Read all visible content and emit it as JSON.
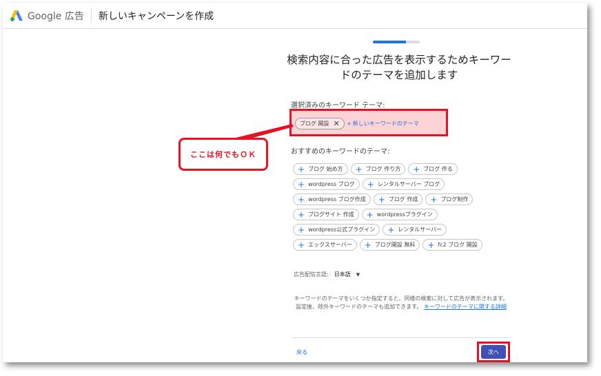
{
  "header": {
    "brand": "Google 広告",
    "title": "新しいキャンペーンを作成"
  },
  "progress": {
    "fraction": 0.7
  },
  "heading": "検索内容に合った広告を表示するためキーワードのテーマを追加します",
  "selected": {
    "label": "選択済みのキーワード テーマ:",
    "chips": [
      "ブログ 開設"
    ],
    "add_label": "新しいキーワードのテーマ"
  },
  "callout": "ここは何でもＯＫ",
  "suggested": {
    "label": "おすすめのキーワードのテーマ:",
    "rows": [
      [
        "ブログ 始め方",
        "ブログ 作り方",
        "ブログ 作る"
      ],
      [
        "wordpress ブログ",
        "レンタルサーバー ブログ"
      ],
      [
        "wordpress ブログ作成",
        "ブログ 作成",
        "ブログ制作"
      ],
      [
        "ブログサイト 作成",
        "wordpressプラグイン"
      ],
      [
        "wordpress公式プラグイン",
        "レンタルサーバー"
      ],
      [
        "エックスサーバー",
        "ブログ開設 無料",
        "fc2 ブログ 開設"
      ]
    ]
  },
  "language": {
    "label": "広告配信言語:",
    "value": "日本語"
  },
  "info": {
    "text": "キーワードのテーマをいくつか指定すると、同様の検索に対して広告が表示されます。設定後、除外キーワードのテーマも追加できます。",
    "link": "キーワードのテーマに関する詳細"
  },
  "footer": {
    "back": "戻る",
    "next": "次へ"
  },
  "colors": {
    "accent": "#1a73e8",
    "highlight": "#e81123",
    "next_button": "#3f51b5"
  }
}
